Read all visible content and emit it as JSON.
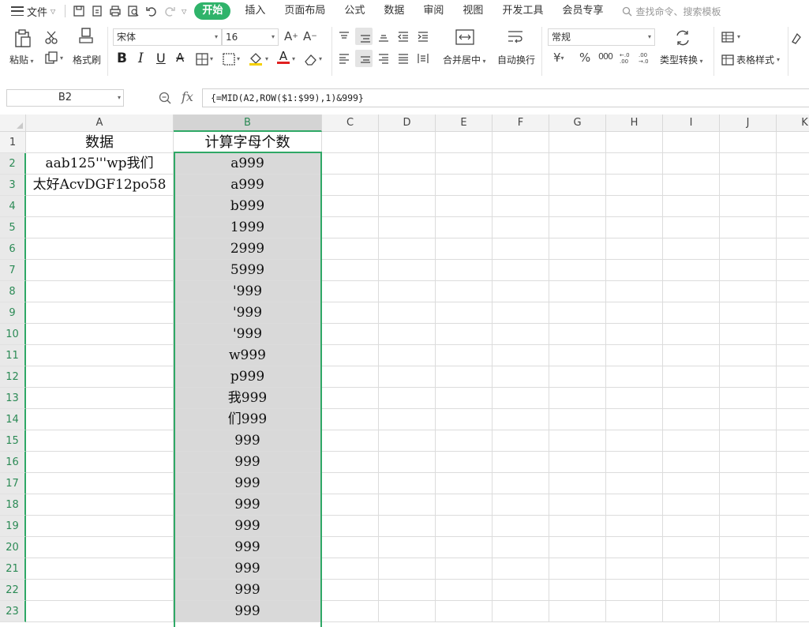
{
  "menubar": {
    "file_label": "文件",
    "tabs": [
      "开始",
      "插入",
      "页面布局",
      "公式",
      "数据",
      "审阅",
      "视图",
      "开发工具",
      "会员专享"
    ],
    "search_placeholder": "查找命令、搜索模板"
  },
  "ribbon": {
    "paste_label": "粘贴",
    "format_painter_label": "格式刷",
    "font_name": "宋体",
    "font_size": "16",
    "merge_label": "合并居中",
    "wrap_label": "自动换行",
    "number_format": "常规",
    "type_convert_label": "类型转换",
    "table_style_label": "表格样式",
    "currency_symbol": "¥",
    "percent_symbol": "%",
    "thousands_symbol": "000"
  },
  "formula_bar": {
    "name_box": "B2",
    "fx_label": "fx",
    "formula": "{=MID(A2,ROW($1:$99),1)&999}"
  },
  "sheet": {
    "columns": [
      "A",
      "B",
      "C",
      "D",
      "E",
      "F",
      "G",
      "H",
      "I",
      "J",
      "K"
    ],
    "rows": [
      "1",
      "2",
      "3",
      "4",
      "5",
      "6",
      "7",
      "8",
      "9",
      "10",
      "11",
      "12",
      "13",
      "14",
      "15",
      "16",
      "17",
      "18",
      "19",
      "20",
      "21",
      "22",
      "23"
    ],
    "A": [
      "数据",
      "aab125'''wp我们",
      "太好AcvDGF12po58",
      "",
      "",
      "",
      "",
      "",
      "",
      "",
      "",
      "",
      "",
      "",
      "",
      "",
      "",
      "",
      "",
      "",
      "",
      "",
      ""
    ],
    "B": [
      "计算字母个数",
      "a999",
      "a999",
      "b999",
      "1999",
      "2999",
      "5999",
      "'999",
      "'999",
      "'999",
      "w999",
      "p999",
      "我999",
      "们999",
      "999",
      "999",
      "999",
      "999",
      "999",
      "999",
      "999",
      "999",
      "999"
    ]
  }
}
